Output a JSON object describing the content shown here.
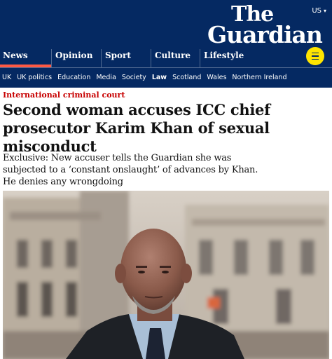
{
  "header": {
    "edition": "US",
    "logo_line1": "The",
    "logo_line2": "Guardian"
  },
  "nav": {
    "pillars": [
      "News",
      "Opinion",
      "Sport",
      "Culture",
      "Lifestyle"
    ],
    "active": "News",
    "subnav": [
      "UK",
      "UK politics",
      "Education",
      "Media",
      "Society",
      "Law",
      "Scotland",
      "Wales",
      "Northern Ireland"
    ],
    "subnav_active": "Law"
  },
  "article": {
    "kicker": "International criminal court",
    "headline": "Second woman accuses ICC chief prosecutor Karim Khan of sexual misconduct",
    "standfirst": "Exclusive: New accuser tells the Guardian she was subjected to a ‘constant onslaught’ of advances by Khan. He denies any wrongdoing"
  },
  "colors": {
    "brand_blue": "#052962",
    "pillar_news": "#ff5943",
    "kicker_red": "#c70000",
    "menu_yellow": "#ffe500"
  },
  "icons": {
    "menu": "hamburger-icon",
    "edition": "chevron-down-icon"
  }
}
